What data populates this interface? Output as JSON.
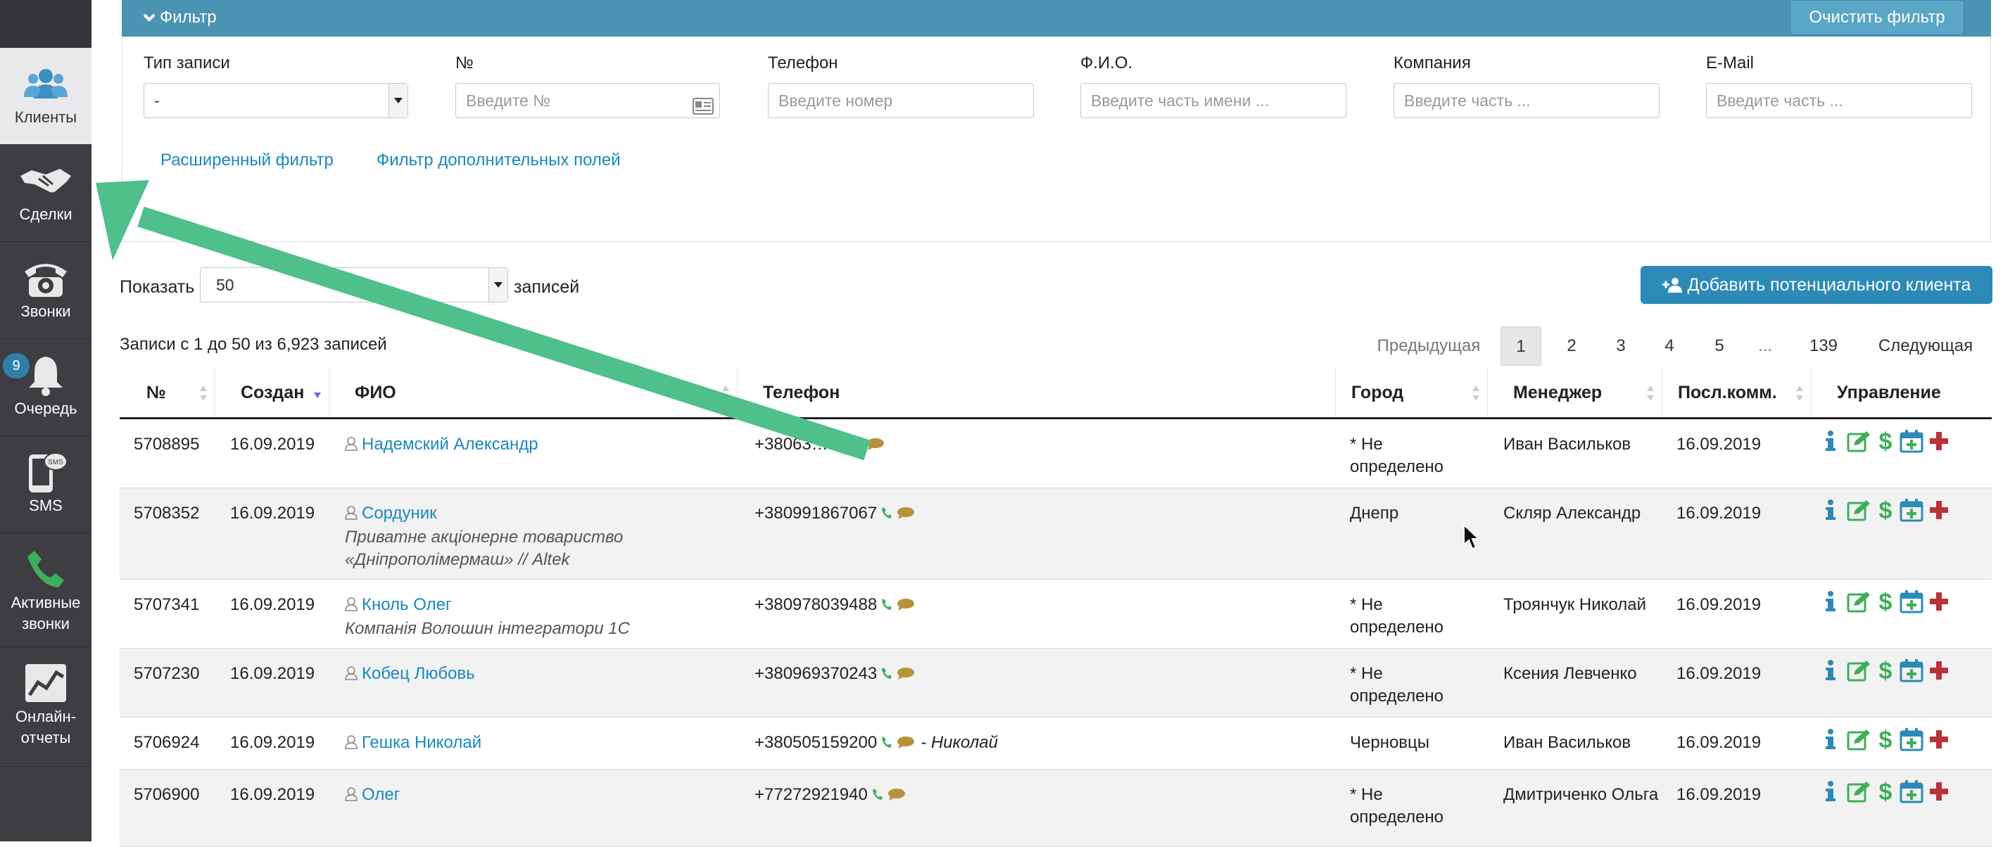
{
  "sidebar": {
    "items": [
      {
        "label": "Клиенты",
        "icon": "users-icon",
        "active": true
      },
      {
        "label": "Сделки",
        "icon": "handshake-icon"
      },
      {
        "label": "Звонки",
        "icon": "phone-rotary-icon"
      },
      {
        "label": "Очередь",
        "icon": "bell-icon",
        "badge": "9"
      },
      {
        "label": "SMS",
        "icon": "sms-phone-icon"
      },
      {
        "label": "Активные звонки",
        "icon": "phone-handset-icon"
      },
      {
        "label": "Онлайн-отчеты",
        "icon": "chart-line-icon"
      }
    ]
  },
  "filter": {
    "title": "Фильтр",
    "clear_label": "Очистить фильтр",
    "fields": [
      {
        "label": "Тип записи",
        "value": "-"
      },
      {
        "label": "№",
        "placeholder": "Введите №"
      },
      {
        "label": "Телефон",
        "placeholder": "Введите номер"
      },
      {
        "label": "Ф.И.О.",
        "placeholder": "Введите часть имени ..."
      },
      {
        "label": "Компания",
        "placeholder": "Введите часть ..."
      },
      {
        "label": "E-Mail",
        "placeholder": "Введите часть ..."
      }
    ],
    "links": [
      "Расширенный фильтр",
      "Фильтр дополнительных полей"
    ]
  },
  "listing": {
    "show_label": "Показать",
    "page_size": "50",
    "records_label": "записей",
    "add_label": "Добавить потенциального клиента",
    "info": "Записи с 1 до 50 из 6,923 записей"
  },
  "pagination": {
    "prev": "Предыдущая",
    "pages": [
      "1",
      "2",
      "3",
      "4",
      "5",
      "...",
      "139"
    ],
    "current": "1",
    "next": "Следующая"
  },
  "table": {
    "columns": [
      "№",
      "Создан",
      "ФИО",
      "Телефон",
      "Город",
      "Менеджер",
      "Посл.комм.",
      "Управление"
    ],
    "rows": [
      {
        "id": "5708895",
        "created": "16.09.2019",
        "name": "Надемский Александр",
        "company": "",
        "phone": "+38063…43",
        "note": "",
        "city": "* Не определено",
        "manager": "Иван Васильков",
        "last": "16.09.2019"
      },
      {
        "id": "5708352",
        "created": "16.09.2019",
        "name": "Сордуник",
        "company": "Приватне акціонерне товариство «Дніпрополімермаш» // Altek",
        "phone": "+380991867067",
        "note": "",
        "city": "Днепр",
        "manager": "Скляр Александр",
        "last": "16.09.2019"
      },
      {
        "id": "5707341",
        "created": "16.09.2019",
        "name": "Кноль Олег",
        "company": "Компанія Волошин інтегратори 1С",
        "phone": "+380978039488",
        "note": "",
        "city": "* Не определено",
        "manager": "Троянчук Николай",
        "last": "16.09.2019"
      },
      {
        "id": "5707230",
        "created": "16.09.2019",
        "name": "Кобец Любовь",
        "company": "",
        "phone": "+380969370243",
        "note": "",
        "city": "* Не определено",
        "manager": "Ксения Левченко",
        "last": "16.09.2019"
      },
      {
        "id": "5706924",
        "created": "16.09.2019",
        "name": "Гешка Николай",
        "company": "",
        "phone": "+380505159200",
        "note": "- Николай",
        "city": "Черновцы",
        "manager": "Иван Васильков",
        "last": "16.09.2019"
      },
      {
        "id": "5706900",
        "created": "16.09.2019",
        "name": "Олег",
        "company": "",
        "phone": "+77272921940",
        "note": "",
        "city": "* Не определено",
        "manager": "Дмитриченко Ольга",
        "last": "16.09.2019"
      }
    ]
  },
  "colors": {
    "accent": "#4a93b3",
    "link": "#1a88c0",
    "arrow": "#4fbf8c",
    "sidebar": "#3d3d42"
  }
}
